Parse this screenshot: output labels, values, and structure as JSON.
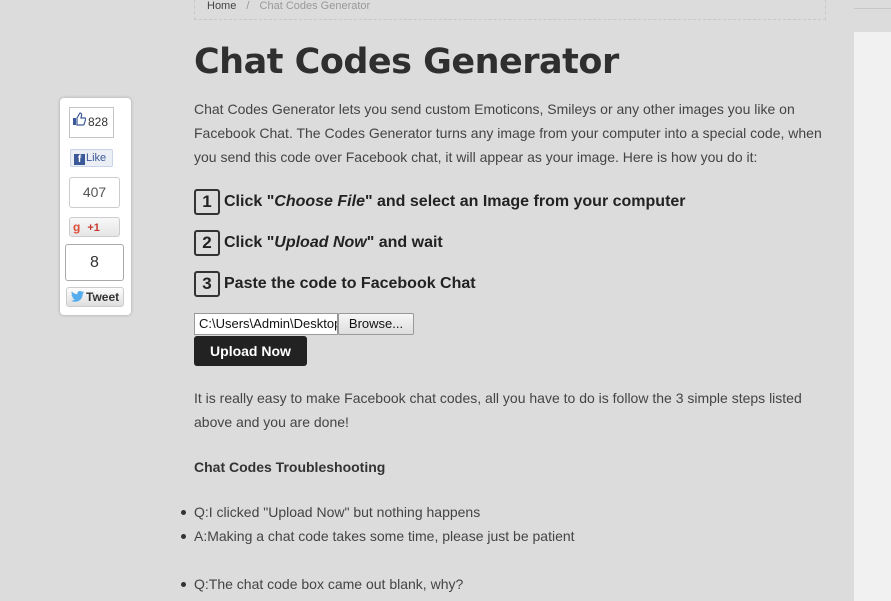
{
  "breadcrumb": {
    "home": "Home",
    "separator": "/",
    "current": "Chat Codes Generator"
  },
  "share": {
    "facebook": {
      "count": "828",
      "like_label": "Like",
      "icon": "thumbs-up-icon"
    },
    "google": {
      "count": "407",
      "plus_label": "+1",
      "g_label": "g"
    },
    "twitter": {
      "count": "8",
      "tweet_label": "Tweet",
      "icon": "twitter-bird-icon"
    }
  },
  "main": {
    "title": "Chat Codes Generator",
    "intro": "Chat Codes Generator lets you send custom Emoticons, Smileys or any other images you like on Facebook Chat. The Codes Generator turns any image from your computer into a special code, when you send this code over Facebook chat, it will appear as your image. Here is how you do it:",
    "steps": [
      {
        "num": "1",
        "pre": "Click \"",
        "em": "Choose File",
        "post": "\" and select an Image from your computer"
      },
      {
        "num": "2",
        "pre": "Click \"",
        "em": "Upload Now",
        "post": "\" and wait"
      },
      {
        "num": "3",
        "text": "Paste the code to Facebook Chat"
      }
    ],
    "file_input": {
      "value": "C:\\Users\\Admin\\Desktop",
      "browse_label": "Browse..."
    },
    "upload_label": "Upload Now",
    "easy_text": "It is really easy to make Facebook chat codes, all you have to do is follow the 3 simple steps listed above and you are done!",
    "troubleshooting_title": "Chat Codes Troubleshooting",
    "faq": [
      "Q:I clicked \"Upload Now\" but nothing happens",
      "A:Making a chat code takes some time, please just be patient",
      "Q:The chat code box came out blank, why?"
    ]
  }
}
